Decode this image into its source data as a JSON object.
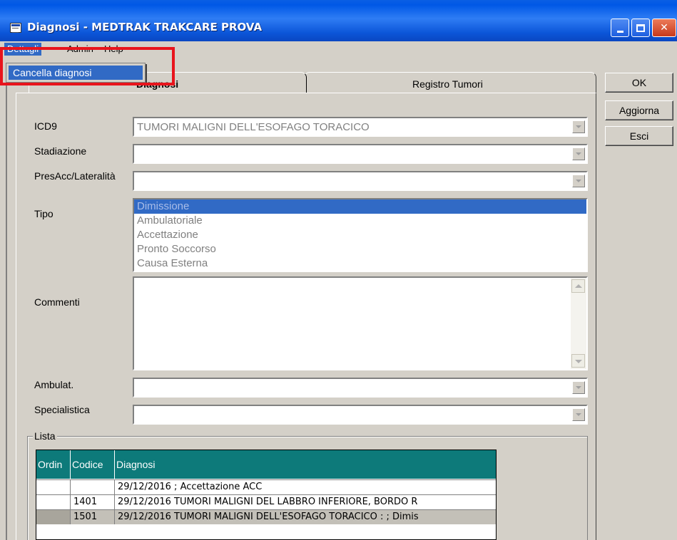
{
  "window": {
    "title": "Diagnosi - MEDTRAK TRAKCARE PROVA",
    "controls": {
      "minimize": "minimize-icon",
      "maximize": "maximize-icon",
      "close": "close-icon"
    }
  },
  "menu": {
    "items": [
      "Dettagli",
      "Admin",
      "Help"
    ],
    "open_menu": "Dettagli",
    "dropdown_items": [
      "Cancella diagnosi"
    ]
  },
  "tabs": [
    "Diagnosi",
    "Registro Tumori"
  ],
  "buttons": {
    "ok": "OK",
    "aggiorna": "Aggiorna",
    "esci": "Esci"
  },
  "form": {
    "icd9": {
      "label": "ICD9",
      "value": "TUMORI MALIGNI DELL'ESOFAGO TORACICO"
    },
    "stadiazione": {
      "label": "Stadiazione",
      "value": ""
    },
    "presacc": {
      "label": "PresAcc/Lateralità",
      "value": ""
    },
    "tipo": {
      "label": "Tipo",
      "options": [
        "Dimissione",
        "Ambulatoriale",
        "Accettazione",
        "Pronto Soccorso",
        "Causa Esterna"
      ],
      "selected": "Dimissione"
    },
    "commenti": {
      "label": "Commenti",
      "value": ""
    },
    "ambulat": {
      "label": "Ambulat.",
      "value": ""
    },
    "specialistica": {
      "label": "Specialistica",
      "value": ""
    }
  },
  "lista": {
    "label": "Lista",
    "columns": [
      "Ordin",
      "Codice",
      "Diagnosi"
    ],
    "rows": [
      {
        "ordine": "",
        "codice": "",
        "diagnosi": "29/12/2016  ; Accettazione ACC"
      },
      {
        "ordine": "",
        "codice": "1401",
        "diagnosi": "29/12/2016 TUMORI MALIGNI DEL LABBRO INFERIORE, BORDO R"
      },
      {
        "ordine": "",
        "codice": "1501",
        "diagnosi": "29/12/2016 TUMORI MALIGNI DELL'ESOFAGO TORACICO :  ; Dimis"
      }
    ]
  },
  "colors": {
    "title_bar": "#0058e6",
    "menu_highlight": "#316ac5",
    "annotation_box": "#e8141c",
    "grid_header": "#0d7a7a",
    "selected_row": "#c3c0b8"
  }
}
